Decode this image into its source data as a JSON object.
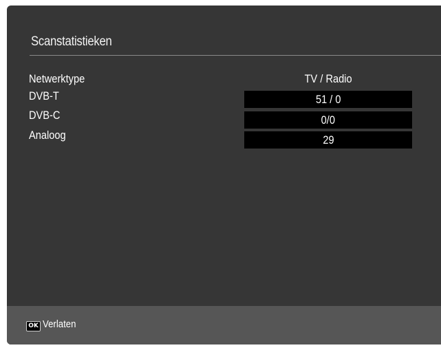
{
  "dialog": {
    "title": "Scanstatistieken"
  },
  "table": {
    "label_header": "Netwerktype",
    "value_header": "TV / Radio",
    "rows": [
      {
        "label": "DVB-T",
        "value": "51 / 0"
      },
      {
        "label": "DVB-C",
        "value": "0/0"
      },
      {
        "label": "Analoog",
        "value": "29"
      }
    ]
  },
  "footer": {
    "ok_icon_text": "OK",
    "exit_label": "Verlaten"
  },
  "colors": {
    "panel_bg": "#363636",
    "footer_bg": "#565656",
    "value_box_bg": "#000000",
    "text": "#ffffff"
  }
}
